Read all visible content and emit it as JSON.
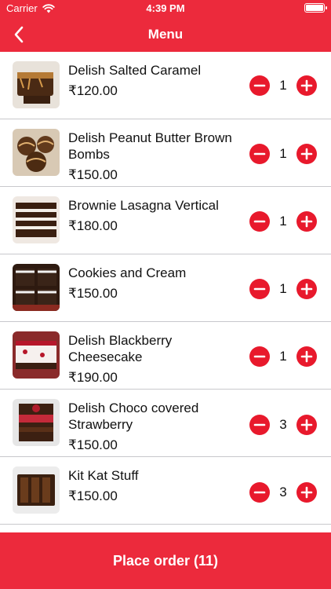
{
  "status_bar": {
    "carrier": "Carrier",
    "time": "4:39 PM"
  },
  "nav": {
    "title": "Menu"
  },
  "items": [
    {
      "name": "Delish Salted Caramel",
      "price": "₹120.00",
      "qty": "1"
    },
    {
      "name": "Delish Peanut Butter Brown Bombs",
      "price": "₹150.00",
      "qty": "1"
    },
    {
      "name": "Brownie Lasagna Vertical",
      "price": "₹180.00",
      "qty": "1"
    },
    {
      "name": "Cookies and Cream",
      "price": "₹150.00",
      "qty": "1"
    },
    {
      "name": "Delish Blackberry Cheesecake",
      "price": "₹190.00",
      "qty": "1"
    },
    {
      "name": "Delish Choco covered Strawberry",
      "price": "₹150.00",
      "qty": "3"
    },
    {
      "name": "Kit Kat Stuff",
      "price": "₹150.00",
      "qty": "3"
    }
  ],
  "footer": {
    "place_order_label": "Place order (11)"
  },
  "colors": {
    "brand_red": "#ec2a3c",
    "button_red": "#e8192c"
  }
}
